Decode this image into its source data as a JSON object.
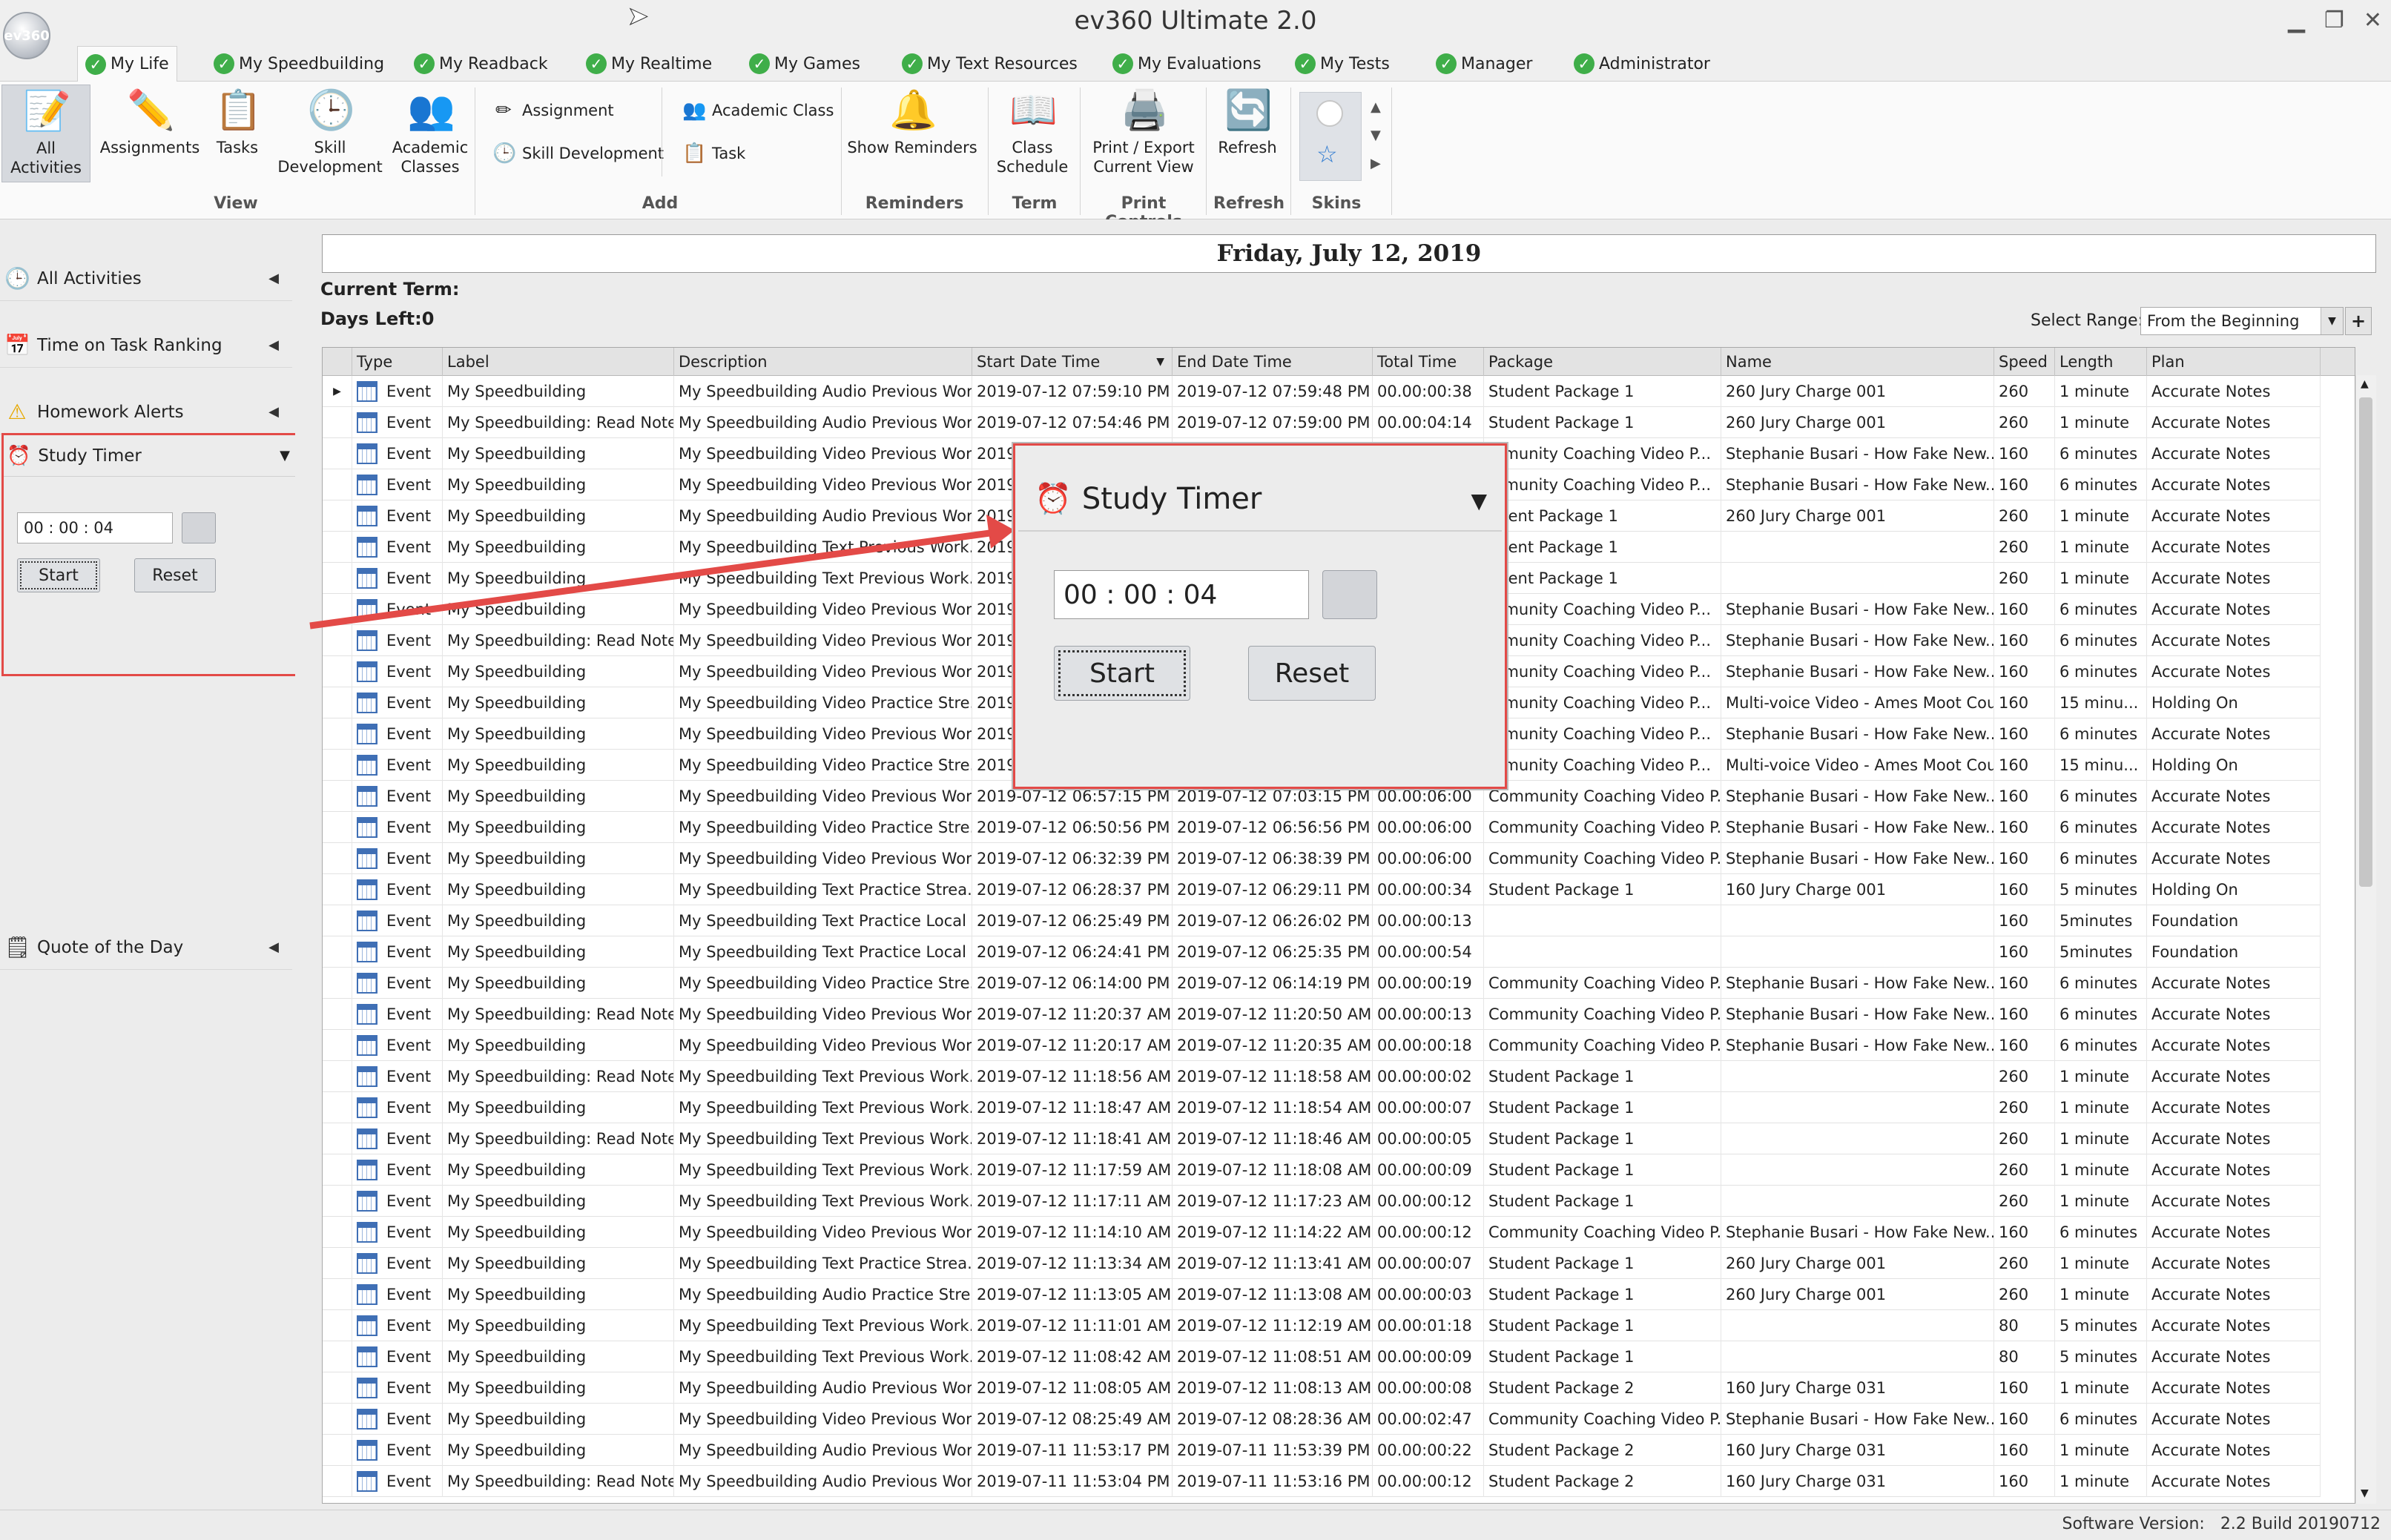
{
  "app": {
    "title": "ev360 Ultimate 2.0",
    "logo_text": "ev360",
    "min": "▁",
    "max": "❐",
    "close": "✕"
  },
  "menu_tabs": [
    {
      "label": "My Life"
    },
    {
      "label": "My Speedbuilding"
    },
    {
      "label": "My Readback"
    },
    {
      "label": "My Realtime"
    },
    {
      "label": "My Games"
    },
    {
      "label": "My Text Resources"
    },
    {
      "label": "My Evaluations"
    },
    {
      "label": "My Tests"
    },
    {
      "label": "Manager"
    },
    {
      "label": "Administrator"
    }
  ],
  "ribbon": {
    "all_activities": "All Activities",
    "assignments": "Assignments",
    "tasks": "Tasks",
    "skill_development_1": "Skill",
    "skill_development_2": "Development",
    "academic_classes_1": "Academic",
    "academic_classes_2": "Classes",
    "view_group": "View",
    "add_assignment": "Assignment",
    "add_skill_development": "Skill Development",
    "add_academic_class": "Academic Class",
    "add_task": "Task",
    "add_group": "Add",
    "show_reminders": "Show Reminders",
    "reminders_group": "Reminders",
    "class_schedule_1": "Class",
    "class_schedule_2": "Schedule",
    "term_group": "Term",
    "print_export_1": "Print / Export",
    "print_export_2": "Current View",
    "print_group": "Print Controls",
    "refresh": "Refresh",
    "refresh_group": "Refresh",
    "skins_group": "Skins"
  },
  "sidebar": {
    "all_activities": "All Activities",
    "time_on_task": "Time on Task Ranking",
    "homework_alerts": "Homework Alerts",
    "study_timer": "Study Timer",
    "timer_value": "00 : 00 : 04",
    "start": "Start",
    "reset": "Reset",
    "quote_of_day": "Quote of the Day"
  },
  "main": {
    "date": "Friday, July 12, 2019",
    "current_term_label": "Current Term:",
    "days_left_label": "Days Left:0",
    "select_range_label": "Select Range:",
    "select_range_value": "From the Beginning",
    "add_symbol": "+"
  },
  "grid": {
    "columns": [
      "Type",
      "Label",
      "Description",
      "Start Date Time",
      "End Date Time",
      "Total Time",
      "Package",
      "Name",
      "Speed",
      "Length",
      "Plan"
    ],
    "rows": [
      [
        "Event",
        "My Speedbuilding",
        "My Speedbuilding Audio Previous Wor...",
        "2019-07-12 07:59:10 PM",
        "2019-07-12 07:59:48 PM",
        "00.00:00:38",
        "Student Package 1",
        "260 Jury Charge 001",
        "260",
        "1 minute",
        "Accurate Notes"
      ],
      [
        "Event",
        "My Speedbuilding: Read Notes",
        "My Speedbuilding Audio Previous Wor...",
        "2019-07-12 07:54:46 PM",
        "2019-07-12 07:59:00 PM",
        "00.00:04:14",
        "Student Package 1",
        "260 Jury Charge 001",
        "260",
        "1 minute",
        "Accurate Notes"
      ],
      [
        "Event",
        "My Speedbuilding",
        "My Speedbuilding Video Previous Wor...",
        "2019",
        "",
        "",
        "mmunity Coaching Video P...",
        "Stephanie Busari - How Fake New...",
        "160",
        "6 minutes",
        "Accurate Notes"
      ],
      [
        "Event",
        "My Speedbuilding",
        "My Speedbuilding Video Previous Wor...",
        "2019",
        "",
        "",
        "mmunity Coaching Video P...",
        "Stephanie Busari - How Fake New...",
        "160",
        "6 minutes",
        "Accurate Notes"
      ],
      [
        "Event",
        "My Speedbuilding",
        "My Speedbuilding Audio Previous Wor...",
        "2019",
        "",
        "",
        "udent Package 1",
        "260 Jury Charge 001",
        "260",
        "1 minute",
        "Accurate Notes"
      ],
      [
        "Event",
        "My Speedbuilding",
        "My Speedbuilding Text Previous Work...",
        "2019",
        "",
        "",
        "udent Package 1",
        "",
        "260",
        "1 minute",
        "Accurate Notes"
      ],
      [
        "Event",
        "My Speedbuilding",
        "My Speedbuilding Text Previous Work...",
        "2019",
        "",
        "",
        "udent Package 1",
        "",
        "260",
        "1 minute",
        "Accurate Notes"
      ],
      [
        "Event",
        "My Speedbuilding",
        "My Speedbuilding Video Previous Wor...",
        "2019",
        "",
        "",
        "mmunity Coaching Video P...",
        "Stephanie Busari - How Fake New...",
        "160",
        "6 minutes",
        "Accurate Notes"
      ],
      [
        "Event",
        "My Speedbuilding: Read Notes",
        "My Speedbuilding Video Previous Wor...",
        "2019",
        "",
        "",
        "mmunity Coaching Video P...",
        "Stephanie Busari - How Fake New...",
        "160",
        "6 minutes",
        "Accurate Notes"
      ],
      [
        "Event",
        "My Speedbuilding",
        "My Speedbuilding Video Previous Wor...",
        "2019",
        "",
        "",
        "mmunity Coaching Video P...",
        "Stephanie Busari - How Fake New...",
        "160",
        "6 minutes",
        "Accurate Notes"
      ],
      [
        "Event",
        "My Speedbuilding",
        "My Speedbuilding Video Practice Stre...",
        "2019",
        "",
        "",
        "mmunity Coaching Video P...",
        "Multi-voice Video - Ames Moot Cou...",
        "160",
        "15 minu...",
        "Holding On"
      ],
      [
        "Event",
        "My Speedbuilding",
        "My Speedbuilding Video Previous Wor...",
        "2019",
        "",
        "",
        "mmunity Coaching Video P...",
        "Stephanie Busari - How Fake New...",
        "160",
        "6 minutes",
        "Accurate Notes"
      ],
      [
        "Event",
        "My Speedbuilding",
        "My Speedbuilding Video Practice Stre...",
        "2019",
        "",
        "",
        "mmunity Coaching Video P...",
        "Multi-voice Video - Ames Moot Cou...",
        "160",
        "15 minu...",
        "Holding On"
      ],
      [
        "Event",
        "My Speedbuilding",
        "My Speedbuilding Video Previous Wor...",
        "2019-07-12 06:57:15 PM",
        "2019-07-12 07:03:15 PM",
        "00.00:06:00",
        "Community Coaching Video P...",
        "Stephanie Busari - How Fake New...",
        "160",
        "6 minutes",
        "Accurate Notes"
      ],
      [
        "Event",
        "My Speedbuilding",
        "My Speedbuilding Video Practice Stre...",
        "2019-07-12 06:50:56 PM",
        "2019-07-12 06:56:56 PM",
        "00.00:06:00",
        "Community Coaching Video P...",
        "Stephanie Busari - How Fake New...",
        "160",
        "6 minutes",
        "Accurate Notes"
      ],
      [
        "Event",
        "My Speedbuilding",
        "My Speedbuilding Video Previous Wor...",
        "2019-07-12 06:32:39 PM",
        "2019-07-12 06:38:39 PM",
        "00.00:06:00",
        "Community Coaching Video P...",
        "Stephanie Busari - How Fake New...",
        "160",
        "6 minutes",
        "Accurate Notes"
      ],
      [
        "Event",
        "My Speedbuilding",
        "My Speedbuilding Text Practice Strea...",
        "2019-07-12 06:28:37 PM",
        "2019-07-12 06:29:11 PM",
        "00.00:00:34",
        "Student Package 1",
        "160 Jury Charge 001",
        "160",
        "5 minutes",
        "Holding On"
      ],
      [
        "Event",
        "My Speedbuilding",
        "My Speedbuilding Text Practice Local ...",
        "2019-07-12 06:25:49 PM",
        "2019-07-12 06:26:02 PM",
        "00.00:00:13",
        "",
        "",
        "160",
        "5minutes",
        "Foundation"
      ],
      [
        "Event",
        "My Speedbuilding",
        "My Speedbuilding Text Practice Local ...",
        "2019-07-12 06:24:41 PM",
        "2019-07-12 06:25:35 PM",
        "00.00:00:54",
        "",
        "",
        "160",
        "5minutes",
        "Foundation"
      ],
      [
        "Event",
        "My Speedbuilding",
        "My Speedbuilding Video Practice Stre...",
        "2019-07-12 06:14:00 PM",
        "2019-07-12 06:14:19 PM",
        "00.00:00:19",
        "Community Coaching Video P...",
        "Stephanie Busari - How Fake New...",
        "160",
        "6 minutes",
        "Accurate Notes"
      ],
      [
        "Event",
        "My Speedbuilding: Read Notes",
        "My Speedbuilding Video Previous Wor...",
        "2019-07-12 11:20:37 AM",
        "2019-07-12 11:20:50 AM",
        "00.00:00:13",
        "Community Coaching Video P...",
        "Stephanie Busari - How Fake New...",
        "160",
        "6 minutes",
        "Accurate Notes"
      ],
      [
        "Event",
        "My Speedbuilding",
        "My Speedbuilding Video Previous Wor...",
        "2019-07-12 11:20:17 AM",
        "2019-07-12 11:20:35 AM",
        "00.00:00:18",
        "Community Coaching Video P...",
        "Stephanie Busari - How Fake New...",
        "160",
        "6 minutes",
        "Accurate Notes"
      ],
      [
        "Event",
        "My Speedbuilding: Read Notes",
        "My Speedbuilding Text Previous Work...",
        "2019-07-12 11:18:56 AM",
        "2019-07-12 11:18:58 AM",
        "00.00:00:02",
        "Student Package 1",
        "",
        "260",
        "1 minute",
        "Accurate Notes"
      ],
      [
        "Event",
        "My Speedbuilding",
        "My Speedbuilding Text Previous Work...",
        "2019-07-12 11:18:47 AM",
        "2019-07-12 11:18:54 AM",
        "00.00:00:07",
        "Student Package 1",
        "",
        "260",
        "1 minute",
        "Accurate Notes"
      ],
      [
        "Event",
        "My Speedbuilding: Read Notes",
        "My Speedbuilding Text Previous Work...",
        "2019-07-12 11:18:41 AM",
        "2019-07-12 11:18:46 AM",
        "00.00:00:05",
        "Student Package 1",
        "",
        "260",
        "1 minute",
        "Accurate Notes"
      ],
      [
        "Event",
        "My Speedbuilding",
        "My Speedbuilding Text Previous Work...",
        "2019-07-12 11:17:59 AM",
        "2019-07-12 11:18:08 AM",
        "00.00:00:09",
        "Student Package 1",
        "",
        "260",
        "1 minute",
        "Accurate Notes"
      ],
      [
        "Event",
        "My Speedbuilding",
        "My Speedbuilding Text Previous Work...",
        "2019-07-12 11:17:11 AM",
        "2019-07-12 11:17:23 AM",
        "00.00:00:12",
        "Student Package 1",
        "",
        "260",
        "1 minute",
        "Accurate Notes"
      ],
      [
        "Event",
        "My Speedbuilding",
        "My Speedbuilding Video Previous Wor...",
        "2019-07-12 11:14:10 AM",
        "2019-07-12 11:14:22 AM",
        "00.00:00:12",
        "Community Coaching Video P...",
        "Stephanie Busari - How Fake New...",
        "160",
        "6 minutes",
        "Accurate Notes"
      ],
      [
        "Event",
        "My Speedbuilding",
        "My Speedbuilding Text Practice Strea...",
        "2019-07-12 11:13:34 AM",
        "2019-07-12 11:13:41 AM",
        "00.00:00:07",
        "Student Package 1",
        "260 Jury Charge 001",
        "260",
        "1 minute",
        "Accurate Notes"
      ],
      [
        "Event",
        "My Speedbuilding",
        "My Speedbuilding Audio Practice Stre...",
        "2019-07-12 11:13:05 AM",
        "2019-07-12 11:13:08 AM",
        "00.00:00:03",
        "Student Package 1",
        "260 Jury Charge 001",
        "260",
        "1 minute",
        "Accurate Notes"
      ],
      [
        "Event",
        "My Speedbuilding",
        "My Speedbuilding Text Previous Work...",
        "2019-07-12 11:11:01 AM",
        "2019-07-12 11:12:19 AM",
        "00.00:01:18",
        "Student Package 1",
        "",
        "80",
        "5 minutes",
        "Accurate Notes"
      ],
      [
        "Event",
        "My Speedbuilding",
        "My Speedbuilding Text Previous Work...",
        "2019-07-12 11:08:42 AM",
        "2019-07-12 11:08:51 AM",
        "00.00:00:09",
        "Student Package 1",
        "",
        "80",
        "5 minutes",
        "Accurate Notes"
      ],
      [
        "Event",
        "My Speedbuilding",
        "My Speedbuilding Audio Previous Wor...",
        "2019-07-12 11:08:05 AM",
        "2019-07-12 11:08:13 AM",
        "00.00:00:08",
        "Student Package 2",
        "160 Jury Charge 031",
        "160",
        "1 minute",
        "Accurate Notes"
      ],
      [
        "Event",
        "My Speedbuilding",
        "My Speedbuilding Video Previous Wor...",
        "2019-07-12 08:25:49 AM",
        "2019-07-12 08:28:36 AM",
        "00.00:02:47",
        "Community Coaching Video P...",
        "Stephanie Busari - How Fake New...",
        "160",
        "6 minutes",
        "Accurate Notes"
      ],
      [
        "Event",
        "My Speedbuilding",
        "My Speedbuilding Audio Previous Wor...",
        "2019-07-11 11:53:17 PM",
        "2019-07-11 11:53:39 PM",
        "00.00:00:22",
        "Student Package 2",
        "160 Jury Charge 031",
        "160",
        "1 minute",
        "Accurate Notes"
      ],
      [
        "Event",
        "My Speedbuilding: Read Notes",
        "My Speedbuilding Audio Previous Wor...",
        "2019-07-11 11:53:04 PM",
        "2019-07-11 11:53:16 PM",
        "00.00:00:12",
        "Student Package 2",
        "160 Jury Charge 031",
        "160",
        "1 minute",
        "Accurate Notes"
      ]
    ]
  },
  "callout": {
    "title": "Study Timer",
    "timer_value": "00 : 00 : 04",
    "start": "Start",
    "reset": "Reset",
    "accent_color": "#e34a47"
  },
  "status": {
    "version_label": "Software Version:",
    "version_value": "2.2 Build 20190712"
  }
}
